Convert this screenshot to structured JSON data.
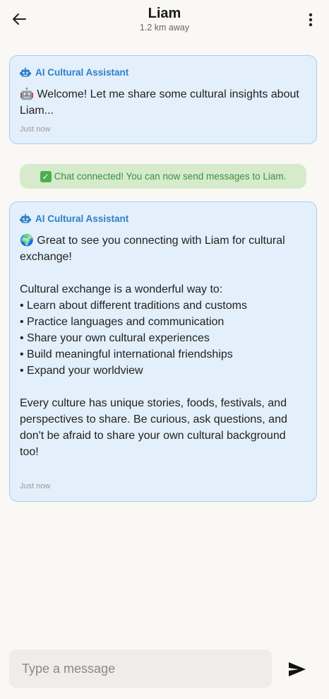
{
  "header": {
    "name": "Liam",
    "distance": "1.2 km away",
    "back_icon": "arrow-left-icon",
    "menu_icon": "more-vertical-icon"
  },
  "messages": [
    {
      "sender": "AI Cultural Assistant",
      "icon": "robot-icon",
      "text": "🤖 Welcome! Let me share some cultural insights about Liam...",
      "time": "Just now"
    },
    {
      "sender": "AI Cultural Assistant",
      "icon": "robot-icon",
      "text": "🌍 Great to see you connecting with Liam for cultural exchange!\n\nCultural exchange is a wonderful way to:\n• Learn about different traditions and customs\n• Practice languages and communication\n• Share your own cultural experiences\n• Build meaningful international friendships\n• Expand your worldview\n\nEvery culture has unique stories, foods, festivals, and perspectives to share. Be curious, ask questions, and don't be afraid to share your own cultural background too!",
      "time": "Just now"
    }
  ],
  "status": {
    "text": "Chat connected! You can now send messages to Liam.",
    "icon": "check-icon"
  },
  "composer": {
    "placeholder": "Type a message",
    "value": "",
    "send_icon": "send-icon"
  },
  "colors": {
    "background": "#faf8f5",
    "assistant_card_bg": "#e3effb",
    "assistant_card_border": "#a9cdeb",
    "assistant_name": "#2f80c8",
    "status_bg": "#d5ebcc",
    "status_text": "#3f8f3f"
  }
}
